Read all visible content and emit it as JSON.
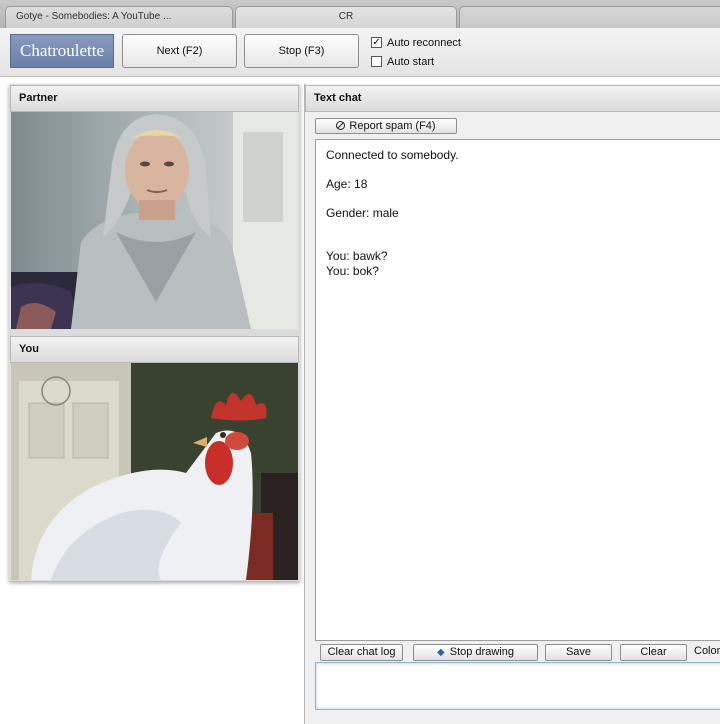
{
  "browser": {
    "tabs": [
      {
        "label": "Gotye - Somebodies: A YouTube ..."
      },
      {
        "label": "CR"
      },
      {
        "label": ""
      }
    ]
  },
  "toolbar": {
    "logo": "Chatroulette",
    "next_label": "Next (F2)",
    "stop_label": "Stop (F3)",
    "auto_reconnect": {
      "label": "Auto reconnect",
      "checked": true,
      "mark": "✓"
    },
    "auto_start": {
      "label": "Auto start",
      "checked": false
    }
  },
  "partner": {
    "title": "Partner"
  },
  "you": {
    "title": "You"
  },
  "chat": {
    "title": "Text chat",
    "report_spam": "Report spam (F4)",
    "messages": [
      "Connected to somebody.",
      "Age: 18",
      "Gender: male",
      "You: bawk?",
      "You: bok?"
    ],
    "clear_chat_log": "Clear chat log",
    "stop_drawing": "Stop drawing",
    "save": "Save",
    "clear": "Clear",
    "color_label": "Color"
  },
  "colors": {
    "logo_bg": "#6a7ea8",
    "input_border": "#8fb3d6"
  }
}
